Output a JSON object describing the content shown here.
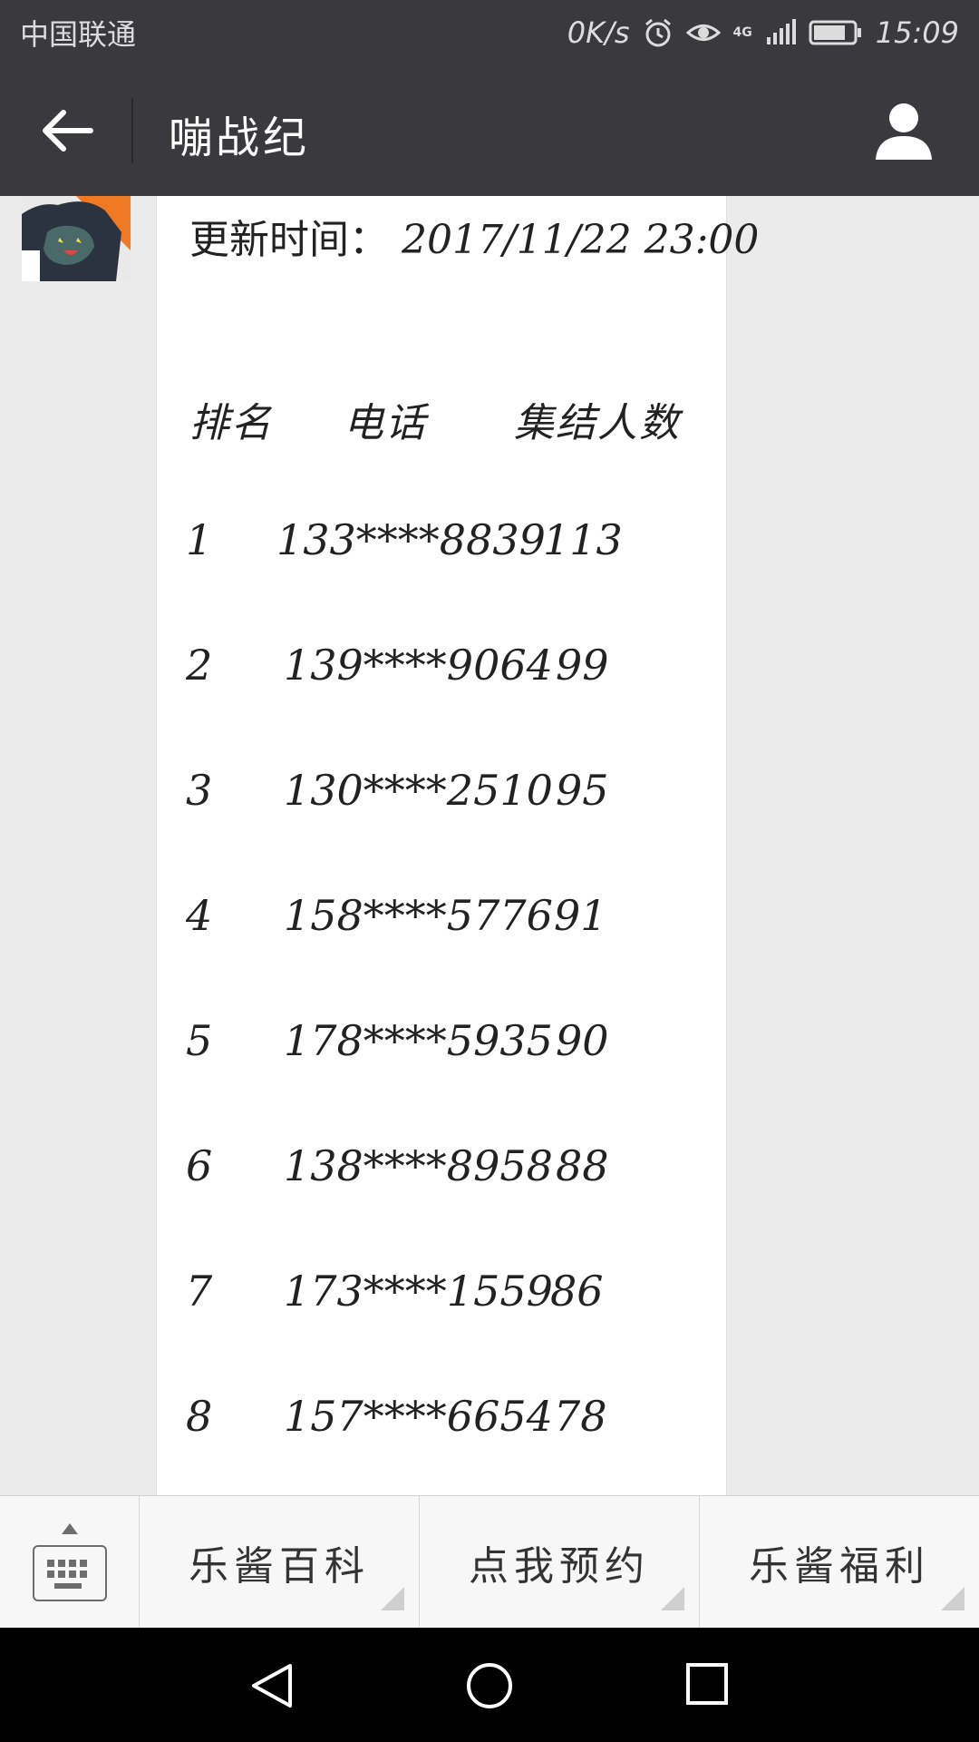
{
  "status_bar": {
    "carrier": "中国联通",
    "speed": "0K/s",
    "network": "4G",
    "time": "15:09"
  },
  "header": {
    "title": "嘣战纪"
  },
  "message": {
    "update_label": "更新时间：",
    "update_time": "2017/11/22 23:00",
    "columns": [
      "排名",
      "电话",
      "集结人数"
    ],
    "rows": [
      {
        "rank": "1",
        "phone": "133****8839",
        "count": "113"
      },
      {
        "rank": "2",
        "phone": "139****9064",
        "count": "99"
      },
      {
        "rank": "3",
        "phone": "130****2510",
        "count": "95"
      },
      {
        "rank": "4",
        "phone": "158****5776",
        "count": "91"
      },
      {
        "rank": "5",
        "phone": "178****5935",
        "count": "90"
      },
      {
        "rank": "6",
        "phone": "138****8958",
        "count": "88"
      },
      {
        "rank": "7",
        "phone": "173****1559",
        "count": "86"
      },
      {
        "rank": "8",
        "phone": "157****6654",
        "count": "78"
      }
    ]
  },
  "menu": {
    "items": [
      "乐酱百科",
      "点我预约",
      "乐酱福利"
    ]
  }
}
